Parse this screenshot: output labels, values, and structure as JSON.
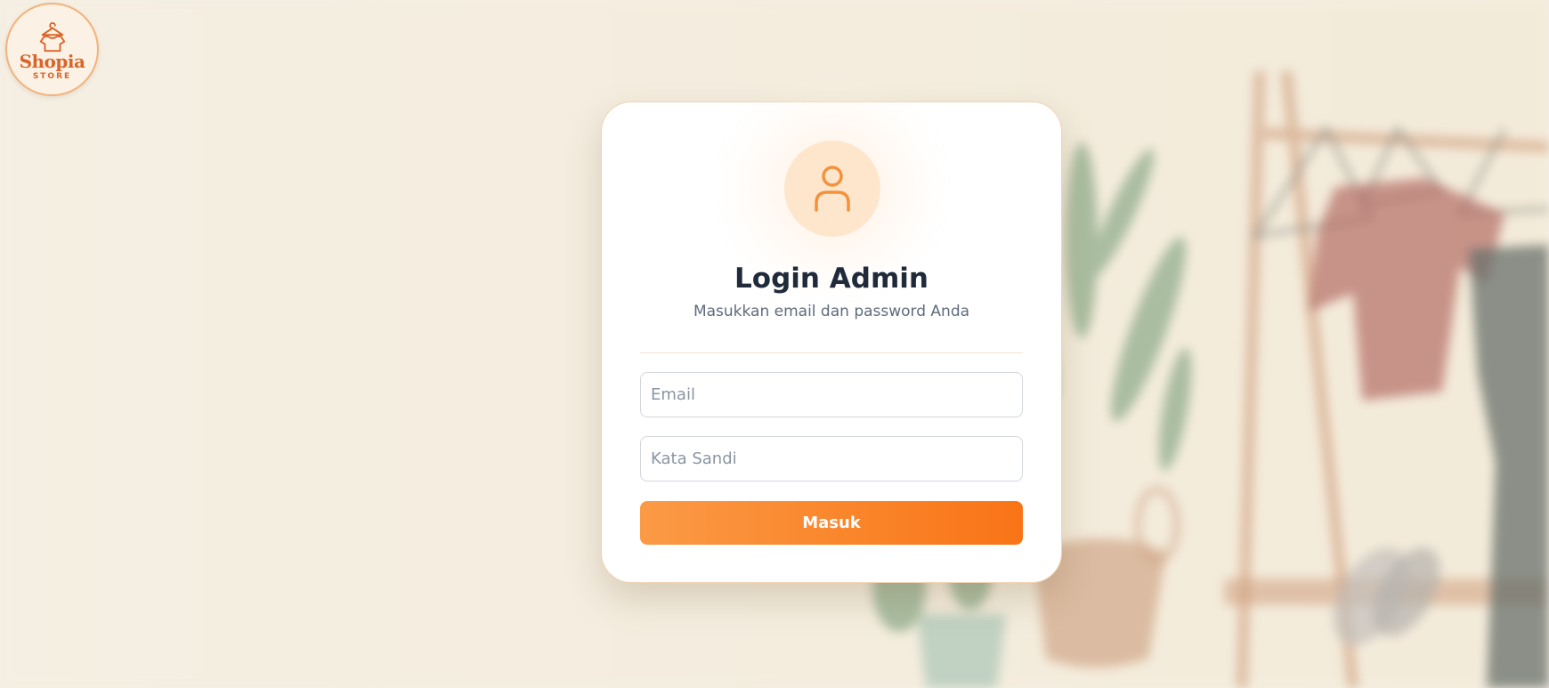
{
  "logo": {
    "name": "Shopia",
    "subtitle": "STORE",
    "icon": "hanger-shirt-icon"
  },
  "login": {
    "avatar_icon": "user-icon",
    "title": "Login Admin",
    "subtitle": "Masukkan email dan password Anda",
    "email": {
      "placeholder": "Email",
      "value": ""
    },
    "password": {
      "placeholder": "Kata Sandi",
      "value": ""
    },
    "submit_label": "Masuk"
  },
  "colors": {
    "accent": "#f97416",
    "accent_light": "#fb9a45",
    "background": "#f5efe3",
    "title": "#1f2a3a"
  }
}
